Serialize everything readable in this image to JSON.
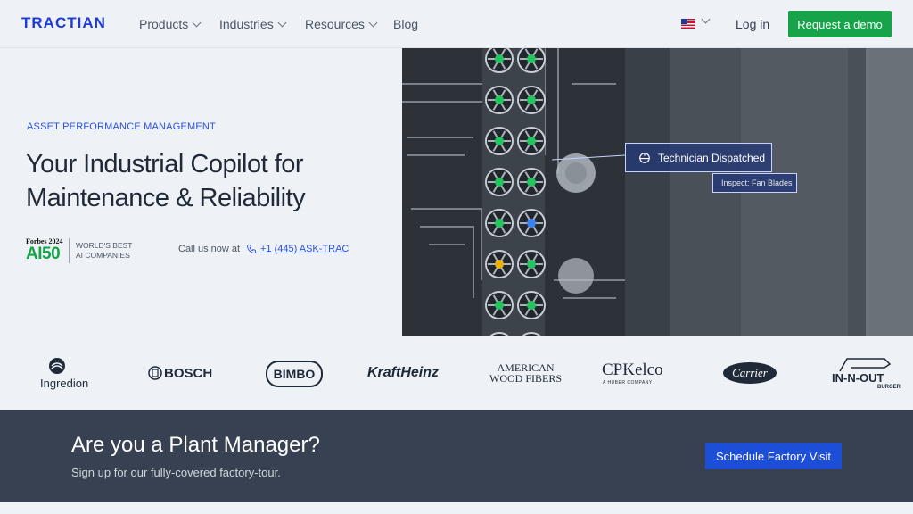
{
  "nav": {
    "logo": "TRACTIAN",
    "items": [
      {
        "label": "Products"
      },
      {
        "label": "Industries"
      },
      {
        "label": "Resources"
      },
      {
        "label": "Blog"
      }
    ],
    "login": "Log in",
    "demo": "Request a demo"
  },
  "hero": {
    "eyebrow": "ASSET PERFORMANCE MANAGEMENT",
    "title_line1": "Your Industrial Copilot for",
    "title_line2": "Maintenance & Reliability",
    "forbes_top": "Forbes 2024",
    "forbes_ai": "AI50",
    "forbes_line1": "WORLD'S BEST",
    "forbes_line2": "AI COMPANIES",
    "call_text": "Call us now at",
    "phone": "+1 (445) ASK-TRAC",
    "badge_main": "Technician Dispatched",
    "badge_sub": "Inspect: Fan Blades"
  },
  "logos": {
    "ingredion": "Ingredion",
    "bosch": "BOSCH",
    "bimbo": "BIMBO",
    "kraftheinz": "KraftHeinz",
    "awf_line1": "AMERICAN",
    "awf_line2": "WOOD FIBERS",
    "cpkelco": "CPKelco",
    "cpkelco_sub": "A HUBER COMPANY",
    "carrier": "Carrier",
    "innout": "IN-N-OUT",
    "innout_sub": "BURGER"
  },
  "cta": {
    "title": "Are you a Plant Manager?",
    "subtitle": "Sign up for our fully-covered factory-tour.",
    "button": "Schedule Factory Visit"
  },
  "colors": {
    "brand_blue": "#1d3bd8",
    "green": "#17a34a",
    "cta_bg": "#374151",
    "cta_button": "#1d4ed8"
  }
}
